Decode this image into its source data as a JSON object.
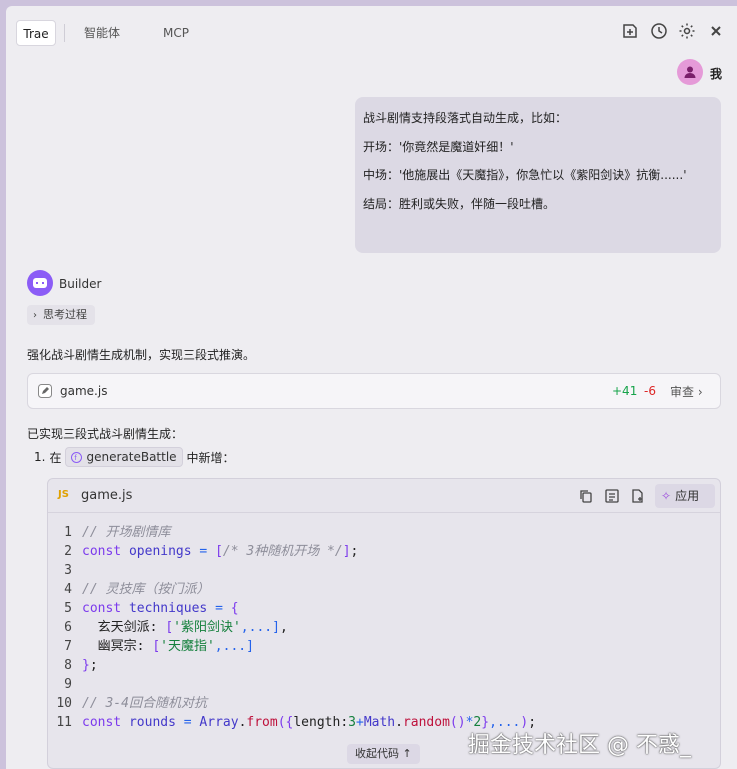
{
  "tabs": [
    "Trae",
    "智能体",
    "MCP"
  ],
  "header_icons": [
    "new-chat-icon",
    "history-icon",
    "settings-icon",
    "close-icon"
  ],
  "user": {
    "name": "我",
    "message": [
      "战斗剧情支持段落式自动生成，比如：",
      "开场：'你竟然是魔道奸细！'",
      "中场：'他施展出《天魔指》，你急忙以《紫阳剑诀》抗衡......'",
      "结局：胜利或失败，伴随一段吐槽。"
    ]
  },
  "assistant": {
    "name": "Builder",
    "thinking_label": "思考过程",
    "summary": "强化战斗剧情生成机制，实现三段式推演。",
    "file_card": {
      "name": "game.js",
      "additions": "+41",
      "deletions": "-6",
      "review_label": "审查"
    },
    "done_text": "已实现三段式战斗剧情生成：",
    "step": {
      "number": "1.",
      "prefix": "在",
      "symbol": "generateBattle",
      "suffix": "中新增："
    }
  },
  "code_block": {
    "lang_badge": "JS",
    "filename": "game.js",
    "apply_label": "应用",
    "collapse_label": "收起代码",
    "lines": [
      {
        "n": "1",
        "tokens": [
          {
            "c": "t-comment",
            "t": "// 开场剧情库"
          }
        ]
      },
      {
        "n": "2",
        "tokens": [
          {
            "c": "t-kw",
            "t": "const "
          },
          {
            "c": "t-id",
            "t": "openings"
          },
          {
            "c": "t-op",
            "t": " = "
          },
          {
            "c": "t-kw",
            "t": "["
          },
          {
            "c": "t-comment",
            "t": "/* 3种随机开场 */"
          },
          {
            "c": "t-kw",
            "t": "]"
          },
          {
            "c": "t-plain",
            "t": ";"
          }
        ]
      },
      {
        "n": "3",
        "tokens": []
      },
      {
        "n": "4",
        "tokens": [
          {
            "c": "t-comment",
            "t": "// 灵技库（按门派）"
          }
        ]
      },
      {
        "n": "5",
        "tokens": [
          {
            "c": "t-kw",
            "t": "const "
          },
          {
            "c": "t-id",
            "t": "techniques"
          },
          {
            "c": "t-op",
            "t": " = "
          },
          {
            "c": "t-kw",
            "t": "{"
          }
        ]
      },
      {
        "n": "6",
        "tokens": [
          {
            "c": "t-plain",
            "t": "  玄天剑派: "
          },
          {
            "c": "t-kw",
            "t": "["
          },
          {
            "c": "t-str",
            "t": "'紫阳剑诀'"
          },
          {
            "c": "t-op",
            "t": ",...]"
          },
          {
            "c": "t-plain",
            "t": ","
          }
        ]
      },
      {
        "n": "7",
        "tokens": [
          {
            "c": "t-plain",
            "t": "  幽冥宗: "
          },
          {
            "c": "t-kw",
            "t": "["
          },
          {
            "c": "t-str",
            "t": "'天魔指'"
          },
          {
            "c": "t-op",
            "t": ",...]"
          }
        ]
      },
      {
        "n": "8",
        "tokens": [
          {
            "c": "t-kw",
            "t": "}"
          },
          {
            "c": "t-plain",
            "t": ";"
          }
        ]
      },
      {
        "n": "9",
        "tokens": []
      },
      {
        "n": "10",
        "tokens": [
          {
            "c": "t-comment",
            "t": "// 3-4回合随机对抗"
          }
        ]
      },
      {
        "n": "11",
        "tokens": [
          {
            "c": "t-kw",
            "t": "const "
          },
          {
            "c": "t-id",
            "t": "rounds"
          },
          {
            "c": "t-op",
            "t": " = "
          },
          {
            "c": "t-id",
            "t": "Array"
          },
          {
            "c": "t-plain",
            "t": "."
          },
          {
            "c": "t-fn",
            "t": "from"
          },
          {
            "c": "t-kw",
            "t": "({"
          },
          {
            "c": "t-plain",
            "t": "length:"
          },
          {
            "c": "t-str",
            "t": "3"
          },
          {
            "c": "t-op",
            "t": "+"
          },
          {
            "c": "t-id",
            "t": "Math"
          },
          {
            "c": "t-plain",
            "t": "."
          },
          {
            "c": "t-fn",
            "t": "random"
          },
          {
            "c": "t-kw",
            "t": "()"
          },
          {
            "c": "t-op",
            "t": "*"
          },
          {
            "c": "t-str",
            "t": "2"
          },
          {
            "c": "t-kw",
            "t": "}"
          },
          {
            "c": "t-op",
            "t": ",..."
          },
          {
            "c": "t-kw",
            "t": ")"
          },
          {
            "c": "t-plain",
            "t": ";"
          }
        ]
      }
    ]
  },
  "watermark": "掘金技术社区 @ 不惑_"
}
